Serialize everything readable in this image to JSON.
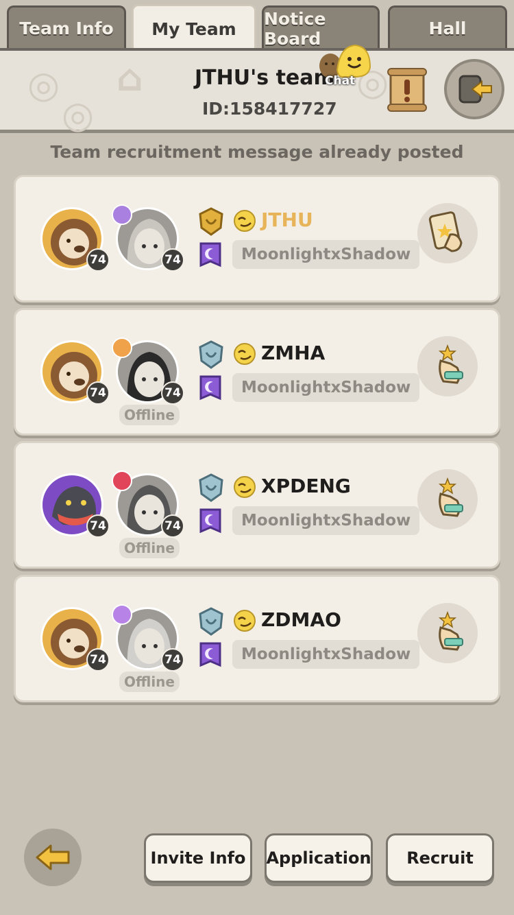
{
  "tabs": [
    {
      "label": "Team Info",
      "active": false
    },
    {
      "label": "My Team",
      "active": true
    },
    {
      "label": "Notice Board",
      "active": false
    },
    {
      "label": "Hall",
      "active": false
    }
  ],
  "header": {
    "team_name": "JTHU's team",
    "team_id": "ID:158417727",
    "chat_label": "Chat"
  },
  "recruit_status": "Team recruitment message already posted",
  "members": [
    {
      "name": "JTHU",
      "guild": "MoonlightxShadow",
      "pet_level": "74",
      "hero_level": "74",
      "status": "",
      "rank": "gold",
      "class_color": "#a97fe0",
      "pet": "lion",
      "leader": true
    },
    {
      "name": "ZMHA",
      "guild": "MoonlightxShadow",
      "pet_level": "74",
      "hero_level": "74",
      "status": "Offline",
      "rank": "silver",
      "class_color": "#f0a24a",
      "pet": "lion",
      "leader": false
    },
    {
      "name": "XPDENG",
      "guild": "MoonlightxShadow",
      "pet_level": "74",
      "hero_level": "74",
      "status": "Offline",
      "rank": "silver",
      "class_color": "#e0455a",
      "pet": "dragon",
      "leader": false
    },
    {
      "name": "ZDMAO",
      "guild": "MoonlightxShadow",
      "pet_level": "74",
      "hero_level": "74",
      "status": "Offline",
      "rank": "silver",
      "class_color": "#b783e6",
      "pet": "lion",
      "leader": false
    }
  ],
  "bottom": {
    "invite_label": "Invite Info",
    "application_label": "Application",
    "recruit_label": "Recruit"
  },
  "icons": {
    "chat": "chat-bubble-icon",
    "notice": "scroll-notice-icon",
    "exit": "exit-team-icon",
    "back": "back-arrow-icon",
    "leader_action": "tap-card-icon",
    "member_action": "swap-hand-icon"
  },
  "colors": {
    "leader_name": "#e7b45a",
    "background": "#c9c2b6",
    "card": "#f3efe7"
  }
}
